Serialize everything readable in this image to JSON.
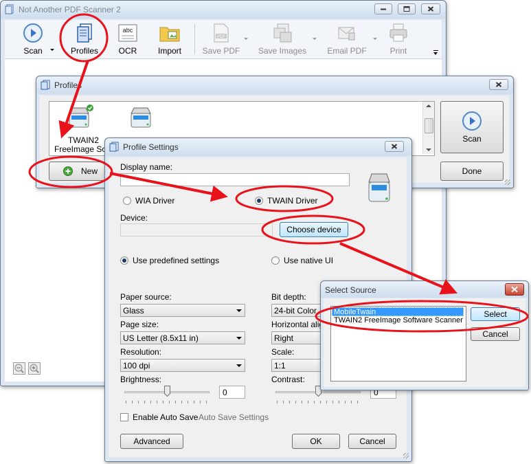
{
  "main_window": {
    "title": "Not Another PDF Scanner 2",
    "toolbar": {
      "scan": "Scan",
      "profiles": "Profiles",
      "ocr": "OCR",
      "import": "Import",
      "save_pdf": "Save PDF",
      "save_images": "Save Images",
      "email_pdf": "Email PDF",
      "print": "Print"
    }
  },
  "profiles_window": {
    "title": "Profiles",
    "profile_label_1": "TWAIN2",
    "profile_label_2": "FreeImage Soft",
    "new_button": "New",
    "scan_button": "Scan",
    "done_button": "Done"
  },
  "profile_settings": {
    "title": "Profile Settings",
    "display_name_label": "Display name:",
    "display_name_value": "",
    "wia_driver": "WIA Driver",
    "twain_driver": "TWAIN Driver",
    "selected_driver": "twain",
    "device_label": "Device:",
    "device_value": "",
    "choose_device_button": "Choose device",
    "use_predefined": "Use predefined settings",
    "use_native": "Use native UI",
    "paper_source_label": "Paper source:",
    "paper_source_value": "Glass",
    "page_size_label": "Page size:",
    "page_size_value": "US Letter (8.5x11 in)",
    "resolution_label": "Resolution:",
    "resolution_value": "100 dpi",
    "brightness_label": "Brightness:",
    "brightness_value": "0",
    "bit_depth_label": "Bit depth:",
    "bit_depth_value": "24-bit Color",
    "horizontal_align_label": "Horizontal alignment:",
    "horizontal_align_value": "Right",
    "scale_label": "Scale:",
    "scale_value": "1:1",
    "contrast_label": "Contrast:",
    "contrast_value": "0",
    "enable_auto_save": "Enable Auto Save",
    "auto_save_settings": "Auto Save Settings",
    "advanced_button": "Advanced",
    "ok_button": "OK",
    "cancel_button": "Cancel"
  },
  "select_source": {
    "title": "Select Source",
    "sources": [
      "MobileTwain",
      "TWAIN2 FreeImage Software Scanner"
    ],
    "selected_index": 0,
    "select_button": "Select",
    "cancel_button": "Cancel"
  },
  "colors": {
    "annotation_red": "#e8121b",
    "selection_blue": "#3399ff",
    "accent_blue": "#2a6fc9"
  }
}
